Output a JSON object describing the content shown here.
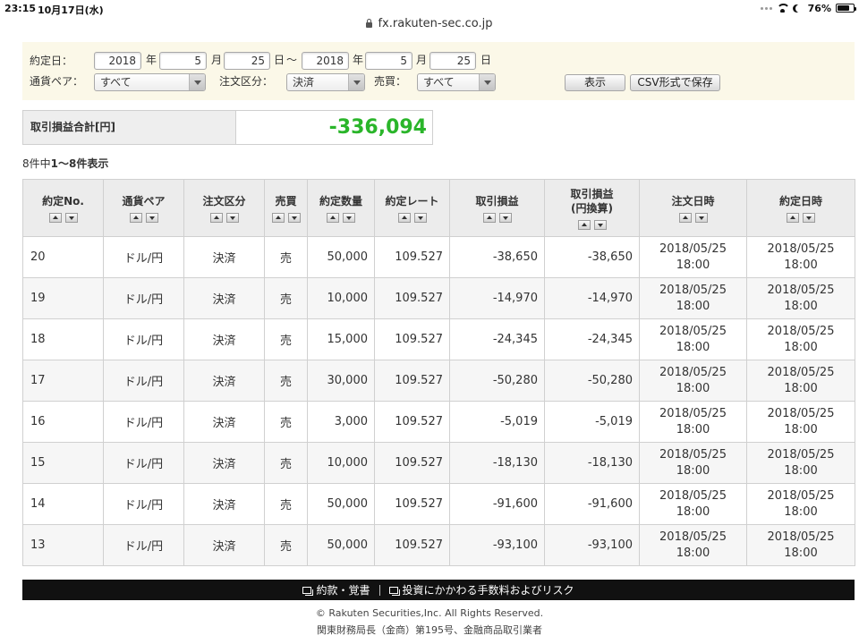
{
  "status_bar": {
    "time": "23:15",
    "date": "10月17日(水)",
    "battery": "76%"
  },
  "browser": {
    "url": "fx.rakuten-sec.co.jp"
  },
  "filter": {
    "date_label": "約定日：",
    "from": {
      "year": "2018",
      "month": "5",
      "day": "25"
    },
    "to": {
      "year": "2018",
      "month": "5",
      "day": "25"
    },
    "year_unit": "年",
    "month_unit": "月",
    "day_unit": "日",
    "range_sep": "〜",
    "currency_label": "通貨ペア：",
    "currency_value": "すべて",
    "order_type_label": "注文区分：",
    "order_type_value": "決済",
    "side_label": "売買：",
    "side_value": "すべて",
    "show_button": "表示",
    "csv_button": "CSV形式で保存"
  },
  "summary": {
    "label": "取引損益合計[円]",
    "value": "-336,094"
  },
  "count": {
    "total": "8件中",
    "range": "1〜8件表示"
  },
  "table": {
    "headers": [
      {
        "label": "約定No."
      },
      {
        "label": "通貨ペア"
      },
      {
        "label": "注文区分"
      },
      {
        "label": "売買"
      },
      {
        "label": "約定数量"
      },
      {
        "label": "約定レート"
      },
      {
        "label": "取引損益"
      },
      {
        "label": "取引損益",
        "sub": "(円換算)"
      },
      {
        "label": "注文日時"
      },
      {
        "label": "約定日時"
      }
    ],
    "rows": [
      {
        "no": "20",
        "pair": "ドル/円",
        "type": "決済",
        "side": "売",
        "qty": "50,000",
        "rate": "109.527",
        "pnl": "-38,650",
        "pnl_jpy": "-38,650",
        "order_date": "2018/05/25",
        "order_time": "18:00",
        "exec_date": "2018/05/25",
        "exec_time": "18:00"
      },
      {
        "no": "19",
        "pair": "ドル/円",
        "type": "決済",
        "side": "売",
        "qty": "10,000",
        "rate": "109.527",
        "pnl": "-14,970",
        "pnl_jpy": "-14,970",
        "order_date": "2018/05/25",
        "order_time": "18:00",
        "exec_date": "2018/05/25",
        "exec_time": "18:00"
      },
      {
        "no": "18",
        "pair": "ドル/円",
        "type": "決済",
        "side": "売",
        "qty": "15,000",
        "rate": "109.527",
        "pnl": "-24,345",
        "pnl_jpy": "-24,345",
        "order_date": "2018/05/25",
        "order_time": "18:00",
        "exec_date": "2018/05/25",
        "exec_time": "18:00"
      },
      {
        "no": "17",
        "pair": "ドル/円",
        "type": "決済",
        "side": "売",
        "qty": "30,000",
        "rate": "109.527",
        "pnl": "-50,280",
        "pnl_jpy": "-50,280",
        "order_date": "2018/05/25",
        "order_time": "18:00",
        "exec_date": "2018/05/25",
        "exec_time": "18:00"
      },
      {
        "no": "16",
        "pair": "ドル/円",
        "type": "決済",
        "side": "売",
        "qty": "3,000",
        "rate": "109.527",
        "pnl": "-5,019",
        "pnl_jpy": "-5,019",
        "order_date": "2018/05/25",
        "order_time": "18:00",
        "exec_date": "2018/05/25",
        "exec_time": "18:00"
      },
      {
        "no": "15",
        "pair": "ドル/円",
        "type": "決済",
        "side": "売",
        "qty": "10,000",
        "rate": "109.527",
        "pnl": "-18,130",
        "pnl_jpy": "-18,130",
        "order_date": "2018/05/25",
        "order_time": "18:00",
        "exec_date": "2018/05/25",
        "exec_time": "18:00"
      },
      {
        "no": "14",
        "pair": "ドル/円",
        "type": "決済",
        "side": "売",
        "qty": "50,000",
        "rate": "109.527",
        "pnl": "-91,600",
        "pnl_jpy": "-91,600",
        "order_date": "2018/05/25",
        "order_time": "18:00",
        "exec_date": "2018/05/25",
        "exec_time": "18:00"
      },
      {
        "no": "13",
        "pair": "ドル/円",
        "type": "決済",
        "side": "売",
        "qty": "50,000",
        "rate": "109.527",
        "pnl": "-93,100",
        "pnl_jpy": "-93,100",
        "order_date": "2018/05/25",
        "order_time": "18:00",
        "exec_date": "2018/05/25",
        "exec_time": "18:00"
      }
    ]
  },
  "footer": {
    "links": [
      "約款・覚書",
      "投資にかかわる手数料およびリスク"
    ],
    "copyright": "© Rakuten Securities,Inc. All Rights Reserved.",
    "registration": "関東財務局長（金商）第195号、金融商品取引業者"
  },
  "colors": {
    "profit_loss": "#2ab52a",
    "side_sell": "#2f6bc4",
    "filter_bg": "#fbf8e8",
    "header_bg": "#ececec",
    "footer_bg": "#111111"
  },
  "icons": {
    "lock": "lock-icon",
    "wifi": "wifi-icon",
    "do_not_disturb": "moon-icon",
    "battery": "battery-icon",
    "select_arrow": "chevron-down-icon",
    "sort_up": "sort-up-icon",
    "sort_down": "sort-down-icon",
    "footer_link": "document-icon"
  }
}
